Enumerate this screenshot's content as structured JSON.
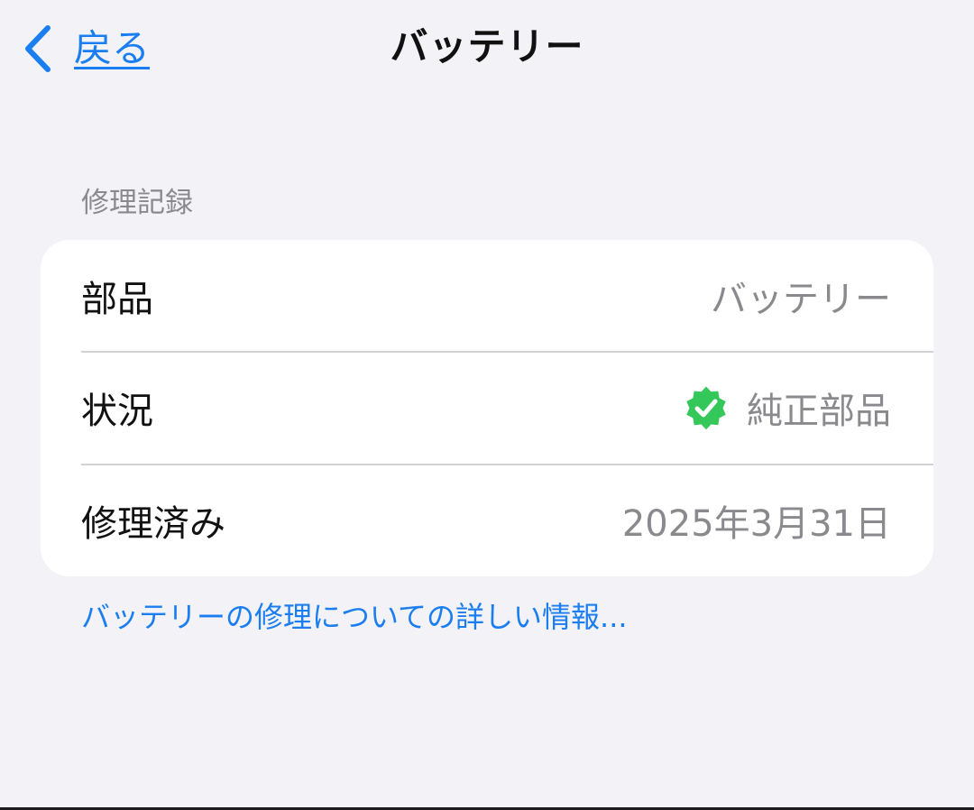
{
  "nav": {
    "back_label": "戻る",
    "back_icon": "chevron-left-icon",
    "title": "バッテリー"
  },
  "section": {
    "header": "修理記録",
    "rows": [
      {
        "label": "部品",
        "value": "バッテリー"
      },
      {
        "label": "状況",
        "value": "純正部品",
        "icon": "verified-badge-icon"
      },
      {
        "label": "修理済み",
        "value": "2025年3月31日"
      }
    ]
  },
  "footer": {
    "link_label": "バッテリーの修理についての詳しい情報..."
  },
  "colors": {
    "accent": "#1a7df0",
    "background": "#f2f2f7",
    "card": "#ffffff",
    "secondary_text": "#8a8a8e",
    "verified_green": "#34c759"
  }
}
